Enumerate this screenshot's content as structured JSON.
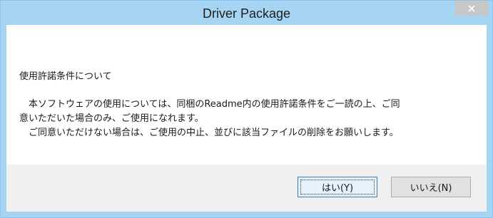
{
  "window": {
    "title": "Driver Package"
  },
  "message": {
    "heading": "使用許諾条件について",
    "lines": [
      "　本ソフトウェアの使用については、同梱のReadme内の使用許諾条件をご一読の上、ご同",
      "意いただいた場合のみ、ご使用になれます。",
      "　ご同意いただけない場合は、ご使用の中止、並びに該当ファイルの削除をお願いします。"
    ]
  },
  "buttons": {
    "yes_label": "はい(Y)",
    "no_label": "いいえ(N)"
  },
  "colors": {
    "frame": "#a6d4f3",
    "close_button": "#c7c7c7",
    "content_background": "#ffffff",
    "footer_background": "#f0f0f0"
  },
  "icons": {
    "close": "close-icon"
  }
}
